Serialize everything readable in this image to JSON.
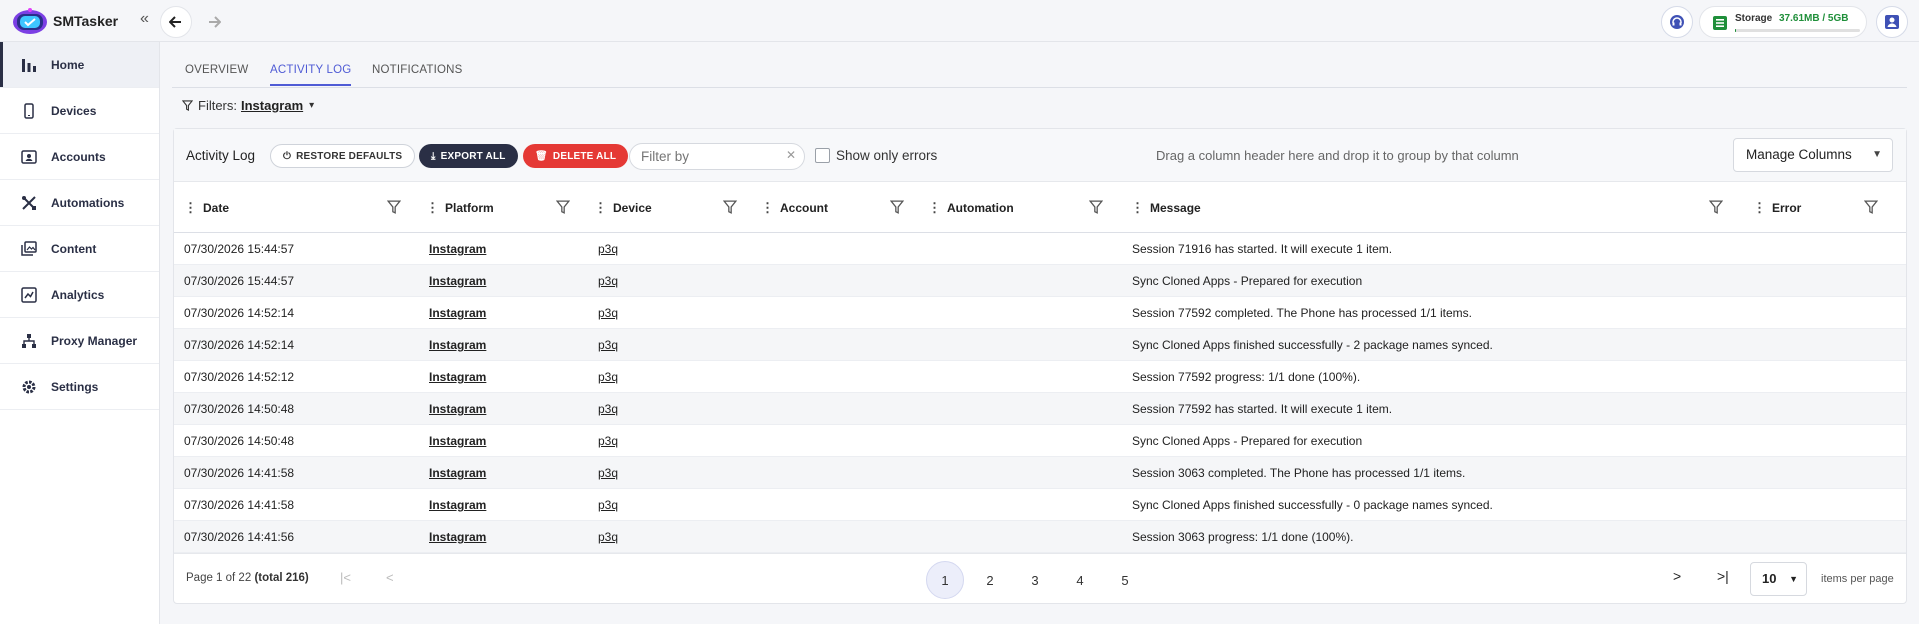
{
  "app": {
    "name": "SMTasker"
  },
  "topbar": {
    "storage_label": "Storage",
    "storage_value": "37.61MB / 5GB",
    "storage_used_fraction": 0.0073
  },
  "sidebar": {
    "items": [
      {
        "label": "Home",
        "icon": "bar-chart-icon",
        "active": true
      },
      {
        "label": "Devices",
        "icon": "phone-icon"
      },
      {
        "label": "Accounts",
        "icon": "account-box-icon"
      },
      {
        "label": "Automations",
        "icon": "tools-icon"
      },
      {
        "label": "Content",
        "icon": "photo-library-icon"
      },
      {
        "label": "Analytics",
        "icon": "analytics-icon"
      },
      {
        "label": "Proxy Manager",
        "icon": "network-icon"
      },
      {
        "label": "Settings",
        "icon": "gear-icon"
      }
    ]
  },
  "tabs": [
    {
      "label": "OVERVIEW"
    },
    {
      "label": "ACTIVITY LOG",
      "active": true
    },
    {
      "label": "NOTIFICATIONS"
    }
  ],
  "filters": {
    "label": "Filters:",
    "value": "Instagram"
  },
  "toolbar": {
    "title": "Activity Log",
    "restore_label": "RESTORE DEFAULTS",
    "export_label": "EXPORT ALL",
    "delete_label": "DELETE ALL",
    "filter_placeholder": "Filter by",
    "errors_label": "Show only errors",
    "group_hint": "Drag a column header here and drop it to group by that column",
    "manage_label": "Manage Columns"
  },
  "columns": [
    "Date",
    "Platform",
    "Device",
    "Account",
    "Automation",
    "Message",
    "Error"
  ],
  "rows": [
    {
      "date": "07/30/2026 15:44:57",
      "platform": "Instagram",
      "device": "p3q",
      "message": "Session 71916 has started. It will execute 1 item."
    },
    {
      "date": "07/30/2026 15:44:57",
      "platform": "Instagram",
      "device": "p3q",
      "message": "Sync Cloned Apps - Prepared for execution"
    },
    {
      "date": "07/30/2026 14:52:14",
      "platform": "Instagram",
      "device": "p3q",
      "message": "Session 77592 completed. The Phone has processed 1/1 items."
    },
    {
      "date": "07/30/2026 14:52:14",
      "platform": "Instagram",
      "device": "p3q",
      "message": "Sync Cloned Apps finished successfully - 2 package names synced."
    },
    {
      "date": "07/30/2026 14:52:12",
      "platform": "Instagram",
      "device": "p3q",
      "message": "Session 77592 progress: 1/1 done (100%)."
    },
    {
      "date": "07/30/2026 14:50:48",
      "platform": "Instagram",
      "device": "p3q",
      "message": "Session 77592 has started. It will execute 1 item."
    },
    {
      "date": "07/30/2026 14:50:48",
      "platform": "Instagram",
      "device": "p3q",
      "message": "Sync Cloned Apps - Prepared for execution"
    },
    {
      "date": "07/30/2026 14:41:58",
      "platform": "Instagram",
      "device": "p3q",
      "message": "Session 3063 completed. The Phone has processed 1/1 items."
    },
    {
      "date": "07/30/2026 14:41:58",
      "platform": "Instagram",
      "device": "p3q",
      "message": "Sync Cloned Apps finished successfully - 0 package names synced."
    },
    {
      "date": "07/30/2026 14:41:56",
      "platform": "Instagram",
      "device": "p3q",
      "message": "Session 3063 progress: 1/1 done (100%)."
    }
  ],
  "pagination": {
    "info_prefix": "Page 1 of 22",
    "info_total": "(total 216)",
    "pages": [
      "1",
      "2",
      "3",
      "4",
      "5"
    ],
    "current": "1",
    "per_page": "10",
    "per_page_label": "items per page"
  }
}
